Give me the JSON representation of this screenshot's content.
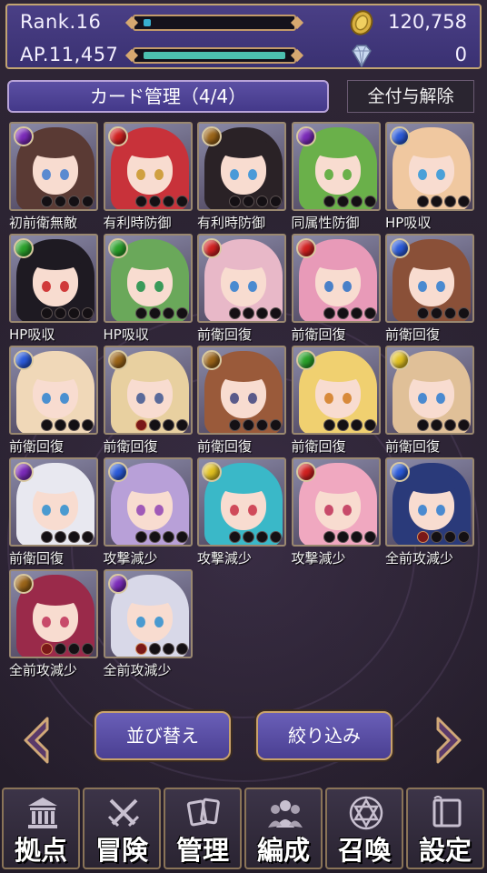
{
  "status": {
    "rank_label": "Rank.16",
    "rank_progress": 0.05,
    "ap_label": "AP.11,457",
    "ap_fill": 1.0,
    "gold_value": "120,758",
    "gem_value": "0",
    "gold_icon": "coin-icon",
    "gem_icon": "diamond-icon"
  },
  "header": {
    "title": "カード管理（4/4）",
    "unequip_all": "全付与解除"
  },
  "cards": [
    {
      "label": "初前衛無敵",
      "element": "purple",
      "hair": "#5a3a34",
      "eyes": "#5a8ad0",
      "equipped": 0
    },
    {
      "label": "有利時防御",
      "element": "red",
      "hair": "#c8323a",
      "eyes": "#d0a040",
      "equipped": 0
    },
    {
      "label": "有利時防御",
      "element": "bronze",
      "hair": "#2a2226",
      "eyes": "#4a9ad8",
      "equipped": 0
    },
    {
      "label": "同属性防御",
      "element": "purple",
      "hair": "#6ab04a",
      "eyes": "#6ab04a",
      "equipped": 0
    },
    {
      "label": "HP吸収",
      "element": "blue",
      "hair": "#f0c8a0",
      "eyes": "#4aa0d8",
      "equipped": 0
    },
    {
      "label": "HP吸収",
      "element": "green",
      "hair": "#1e1a22",
      "eyes": "#d03a3a",
      "equipped": 0
    },
    {
      "label": "HP吸収",
      "element": "green",
      "hair": "#6aa85a",
      "eyes": "#3a9a5a",
      "equipped": 0
    },
    {
      "label": "前衛回復",
      "element": "red",
      "hair": "#e8b8c8",
      "eyes": "#4a8ad0",
      "equipped": 0
    },
    {
      "label": "前衛回復",
      "element": "red",
      "hair": "#e89ab8",
      "eyes": "#4a80c8",
      "equipped": 0
    },
    {
      "label": "前衛回復",
      "element": "blue",
      "hair": "#8a5038",
      "eyes": "#4a8ad0",
      "equipped": 0
    },
    {
      "label": "前衛回復",
      "element": "blue",
      "hair": "#f0d8b8",
      "eyes": "#4a90d0",
      "equipped": 0
    },
    {
      "label": "前衛回復",
      "element": "bronze",
      "hair": "#e8d0a0",
      "eyes": "#5a6a9a",
      "equipped": 1
    },
    {
      "label": "前衛回復",
      "element": "bronze",
      "hair": "#9a5a3a",
      "eyes": "#5a5a8a",
      "equipped": 0
    },
    {
      "label": "前衛回復",
      "element": "green",
      "hair": "#f0d070",
      "eyes": "#d88a3a",
      "equipped": 0
    },
    {
      "label": "前衛回復",
      "element": "yellow",
      "hair": "#e0c098",
      "eyes": "#4a8ad0",
      "equipped": 0
    },
    {
      "label": "前衛回復",
      "element": "purple",
      "hair": "#e8e8f0",
      "eyes": "#4a9ad0",
      "equipped": 0
    },
    {
      "label": "攻撃減少",
      "element": "blue",
      "hair": "#b8a0d8",
      "eyes": "#a05ab8",
      "equipped": 0
    },
    {
      "label": "攻撃減少",
      "element": "yellow",
      "hair": "#3ab8c8",
      "eyes": "#d04a5a",
      "equipped": 0
    },
    {
      "label": "攻撃減少",
      "element": "red",
      "hair": "#f0a8c0",
      "eyes": "#c84a6a",
      "equipped": 0
    },
    {
      "label": "全前攻減少",
      "element": "blue",
      "hair": "#2a3a7a",
      "eyes": "#4a8ad0",
      "equipped": 1
    },
    {
      "label": "全前攻減少",
      "element": "bronze",
      "hair": "#9a2a4a",
      "eyes": "#c84a6a",
      "equipped": 1
    },
    {
      "label": "全前攻減少",
      "element": "purple",
      "hair": "#d8d8e8",
      "eyes": "#4a9ad0",
      "equipped": 1
    }
  ],
  "element_colors": {
    "purple": "#7a2ab8",
    "red": "#d02020",
    "bronze": "#9a6418",
    "green": "#2aa02a",
    "blue": "#2a5ad8",
    "yellow": "#e0c020"
  },
  "controls": {
    "sort_label": "並び替え",
    "filter_label": "絞り込み",
    "prev_icon": "chevron-left-icon",
    "next_icon": "chevron-right-icon"
  },
  "nav": [
    {
      "label": "拠点",
      "icon": "building-icon"
    },
    {
      "label": "冒険",
      "icon": "crossed-swords-icon"
    },
    {
      "label": "管理",
      "icon": "cards-icon"
    },
    {
      "label": "編成",
      "icon": "group-icon"
    },
    {
      "label": "召喚",
      "icon": "hexagram-icon"
    },
    {
      "label": "設定",
      "icon": "book-icon"
    }
  ]
}
